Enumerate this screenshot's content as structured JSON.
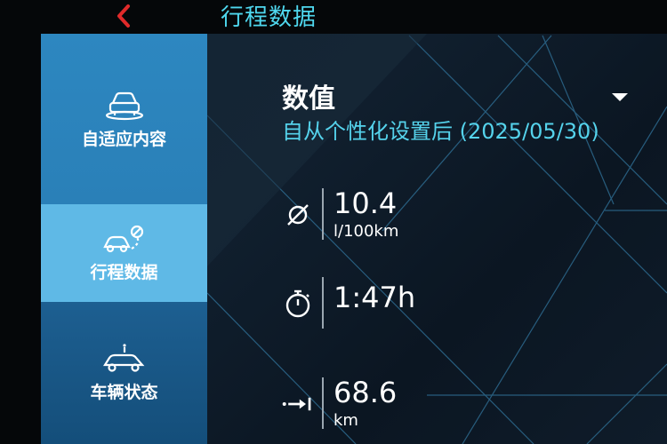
{
  "header": {
    "title": "行程数据"
  },
  "sidebar": {
    "items": [
      {
        "label": "自适应内容",
        "icon": "car-adaptive-icon",
        "active": false
      },
      {
        "label": "行程数据",
        "icon": "car-route-icon",
        "active": true
      },
      {
        "label": "车辆状态",
        "icon": "car-info-icon",
        "active": false
      }
    ]
  },
  "main": {
    "section_title": "数值",
    "subtitle": "自从个性化设置后 (2025/05/30)",
    "metrics": [
      {
        "icon": "average-icon",
        "value": "10.4",
        "unit": "l/100km"
      },
      {
        "icon": "stopwatch-icon",
        "value": "1:47h",
        "unit": ""
      },
      {
        "icon": "distance-icon",
        "value": "68.6",
        "unit": "km"
      }
    ]
  },
  "colors": {
    "accent": "#4fd8ef",
    "sidebar_active": "#5fb9e6",
    "back_arrow": "#e02a2a"
  }
}
